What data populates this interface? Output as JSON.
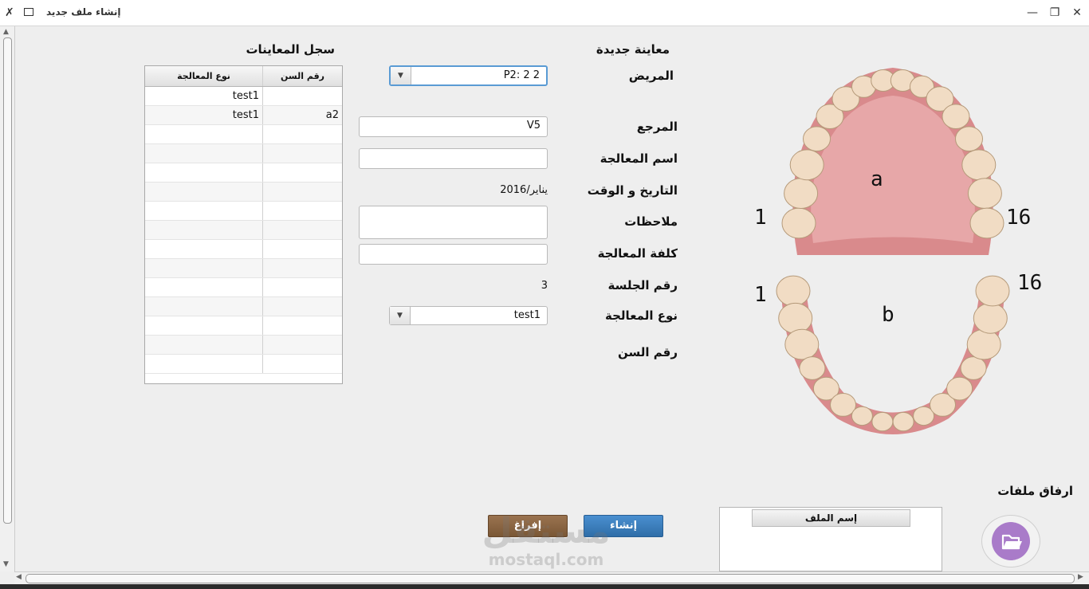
{
  "window": {
    "title": "إنشاء ملف جديد",
    "minimize": "—",
    "restore": "❐",
    "close": "✕"
  },
  "form": {
    "section_title": "معاينة جديدة",
    "patient_label": "المريض",
    "patient_value": "P2: 2 2",
    "reference_label": "المرجع",
    "reference_value": "V5",
    "treatment_name_label": "اسم المعالجة",
    "treatment_name_value": "",
    "datetime_label": "التاريخ و الوقت",
    "datetime_value": "يناير/2016",
    "notes_label": "ملاحظات",
    "notes_value": "",
    "cost_label": "كلفة المعالجة",
    "cost_value": "",
    "session_label": "رقم الجلسة",
    "session_value": "3",
    "treatment_type_label": "نوع المعالجة",
    "treatment_type_value": "test1",
    "tooth_number_label": "رقم السن"
  },
  "history": {
    "title": "سجل المعاينات",
    "columns": [
      "نوع المعالجة",
      "رقم السن"
    ],
    "rows": [
      {
        "type": "test1",
        "tooth": ""
      },
      {
        "type": "test1",
        "tooth": "a2"
      },
      {
        "type": "",
        "tooth": ""
      },
      {
        "type": "",
        "tooth": ""
      },
      {
        "type": "",
        "tooth": ""
      },
      {
        "type": "",
        "tooth": ""
      },
      {
        "type": "",
        "tooth": ""
      },
      {
        "type": "",
        "tooth": ""
      },
      {
        "type": "",
        "tooth": ""
      },
      {
        "type": "",
        "tooth": ""
      },
      {
        "type": "",
        "tooth": ""
      },
      {
        "type": "",
        "tooth": ""
      },
      {
        "type": "",
        "tooth": ""
      },
      {
        "type": "",
        "tooth": ""
      },
      {
        "type": "",
        "tooth": ""
      }
    ]
  },
  "teeth_chart": {
    "upper_label": "a",
    "lower_label": "b",
    "upper_left_num": "1",
    "upper_right_num": "16",
    "lower_left_num": "1",
    "lower_right_num": "16",
    "gum_color": "#d98a8c",
    "tooth_color": "#f1dcc4"
  },
  "attachments": {
    "title": "ارفاق ملفات",
    "column_file_name": "إسم الملف",
    "icon": "folder-icon"
  },
  "buttons": {
    "create": "إنشاء",
    "clear": "إفراغ"
  },
  "watermark": {
    "line1": "مستقل",
    "line2": "mostaql.com"
  },
  "colors": {
    "create_button": "#3f83c4",
    "clear_button": "#8b6543",
    "folder_button": "#a97bc9"
  }
}
